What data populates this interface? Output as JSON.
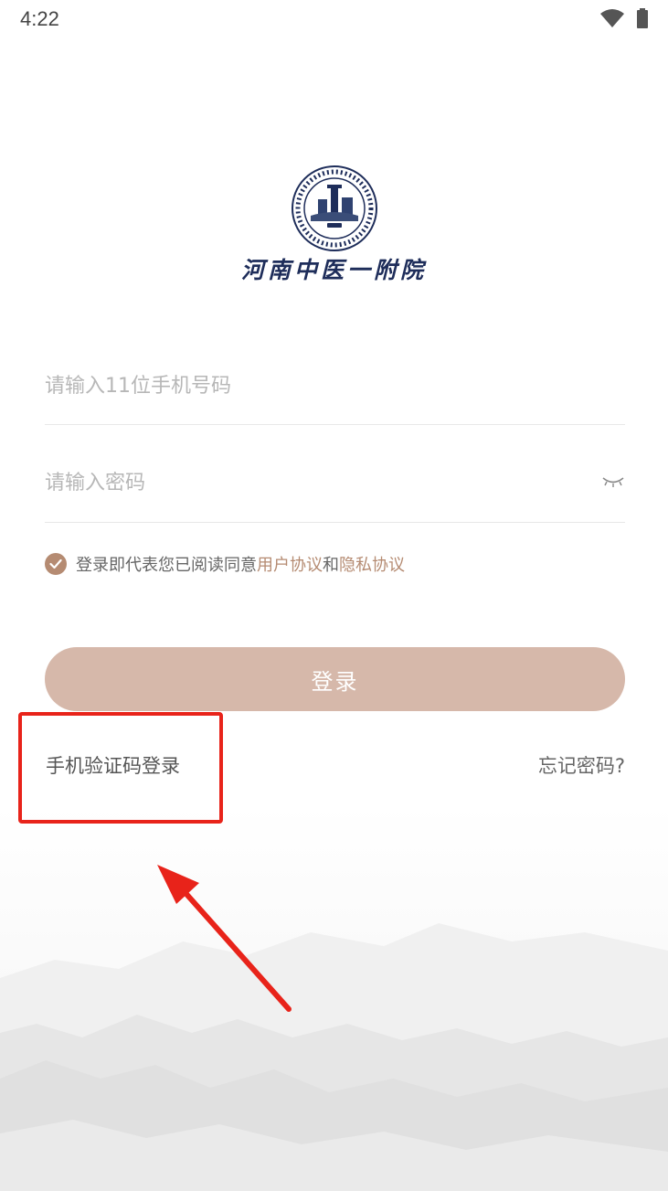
{
  "status_bar": {
    "time": "4:22"
  },
  "logo": {
    "name": "河南中医一附院"
  },
  "form": {
    "phone_placeholder": "请输入11位手机号码",
    "password_placeholder": "请输入密码"
  },
  "agreement": {
    "checked": true,
    "text": "登录即代表您已阅读同意",
    "user_agreement": "用户协议",
    "and": "和",
    "privacy_agreement": "隐私协议"
  },
  "login_button": "登录",
  "sms_login": "手机验证码登录",
  "forgot_password": "忘记密码?",
  "colors": {
    "accent": "#b58b72",
    "button": "#d6b8aa",
    "annotation": "#e8231a"
  }
}
